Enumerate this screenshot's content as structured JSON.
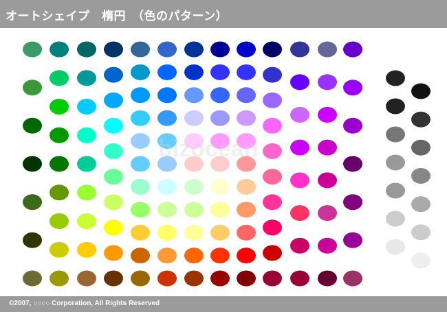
{
  "header": {
    "title": "オートシェイプ　楕円　（色のパターン）"
  },
  "footer": {
    "copyright": "©2007, ○○○○ Corporation, All Rights Reserved"
  },
  "watermark": "bizocean",
  "palette": {
    "columns": [
      {
        "colors": [
          "#3a9a6a",
          "#3a9a3a",
          "#006600",
          "#003300",
          "#3a6a1a",
          "#333300",
          "#6b6b33"
        ]
      },
      {
        "colors": [
          "#007f7f",
          "#00cc66",
          "#00cc00",
          "#009900",
          "#007700",
          "#669900",
          "#99cc00",
          "#cccc00",
          "#999900"
        ]
      },
      {
        "colors": [
          "#006666",
          "#009999",
          "#00ccff",
          "#00ffcc",
          "#00cc99",
          "#99ff33",
          "#ccff33",
          "#ffcc00",
          "#996633"
        ]
      },
      {
        "colors": [
          "#003366",
          "#0066cc",
          "#00aaff",
          "#00ffff",
          "#33ffcc",
          "#66ff99",
          "#ccff66",
          "#ffff00",
          "#ff9900",
          "#663300"
        ]
      },
      {
        "colors": [
          "#336699",
          "#0099cc",
          "#0099ff",
          "#33ccff",
          "#99ccff",
          "#66ccff",
          "#99ffcc",
          "#99ff66",
          "#ffcc33",
          "#cc6600",
          "#996600"
        ]
      },
      {
        "colors": [
          "#3366cc",
          "#0066ff",
          "#0077ff",
          "#3399ff",
          "#66ccff",
          "#99ccff",
          "#ccffff",
          "#ccff99",
          "#ffff66",
          "#ff9933",
          "#cc3300"
        ]
      },
      {
        "colors": [
          "#003399",
          "#0033cc",
          "#6699ff",
          "#ccccff",
          "#ffccff",
          "#ffcccc",
          "#ccffcc",
          "#ccff99",
          "#ffff99",
          "#ff6600",
          "#993300"
        ]
      },
      {
        "colors": [
          "#000099",
          "#3333ff",
          "#3366ff",
          "#9999ff",
          "#ff99ff",
          "#ffcccc",
          "#ffffcc",
          "#ffff99",
          "#ffcc66",
          "#ff3300",
          "#990000"
        ]
      },
      {
        "colors": [
          "#0000cc",
          "#3333ff",
          "#6666ff",
          "#cc99ff",
          "#ff99ff",
          "#ff9999",
          "#ffcc99",
          "#ff9966",
          "#ff6666",
          "#ff0000",
          "#800000"
        ]
      },
      {
        "colors": [
          "#000066",
          "#3333cc",
          "#9966ff",
          "#ff66ff",
          "#ff66cc",
          "#ff6699",
          "#ff3399",
          "#ff0066",
          "#cc0000",
          "#990033"
        ]
      },
      {
        "colors": [
          "#333399",
          "#6600ff",
          "#cc66ff",
          "#cc00ff",
          "#ff33cc",
          "#ff3366",
          "#cc0066",
          "#990033"
        ]
      },
      {
        "colors": [
          "#666699",
          "#9933ff",
          "#cc00ff",
          "#cc00cc",
          "#cc0099",
          "#cc3399",
          "#cc0099",
          "#660033"
        ]
      },
      {
        "colors": [
          "#6600cc",
          "#9900ff",
          "#9900cc",
          "#660066",
          "#800080",
          "#990099",
          "#993366"
        ]
      },
      {
        "colors": [
          "#222222",
          "#222222",
          "#777777",
          "#999999",
          "#999999",
          "#cccccc",
          "#e8e8e8"
        ]
      },
      {
        "colors": [
          "#111111",
          "#333333",
          "#666666",
          "#888888",
          "#aaaaaa",
          "#cccccc",
          "#eeeeee"
        ]
      }
    ]
  }
}
